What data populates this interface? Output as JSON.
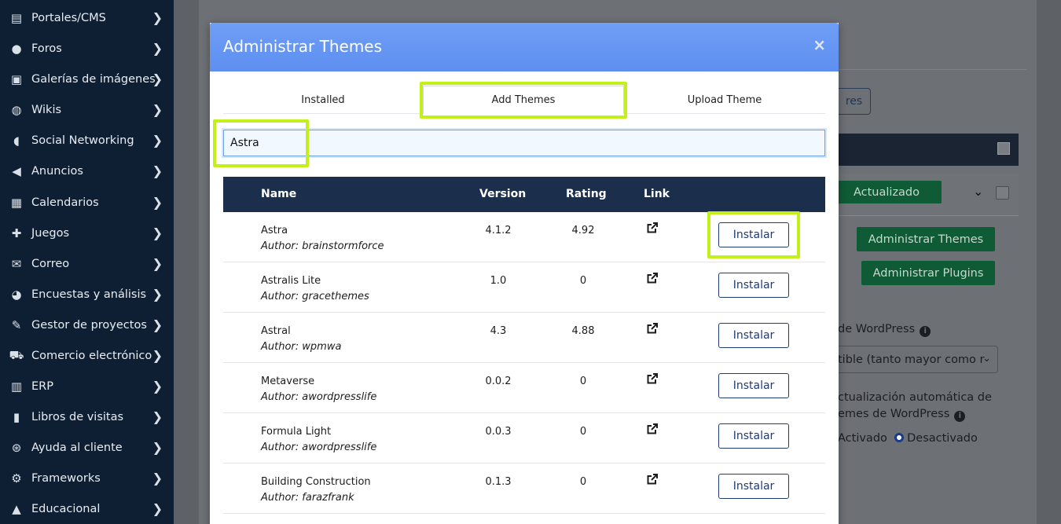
{
  "sidebar": {
    "items": [
      {
        "label": "Portales/CMS",
        "icon": "list-icon"
      },
      {
        "label": "Foros",
        "icon": "users-icon"
      },
      {
        "label": "Galerías de imágenes",
        "icon": "image-icon"
      },
      {
        "label": "Wikis",
        "icon": "globe-icon"
      },
      {
        "label": "Social Networking",
        "icon": "comments-icon"
      },
      {
        "label": "Anuncios",
        "icon": "megaphone-icon"
      },
      {
        "label": "Calendarios",
        "icon": "calendar-icon"
      },
      {
        "label": "Juegos",
        "icon": "gamepad-icon"
      },
      {
        "label": "Correo",
        "icon": "envelope-icon"
      },
      {
        "label": "Encuestas y análisis",
        "icon": "pie-chart-icon"
      },
      {
        "label": "Gestor de proyectos",
        "icon": "edit-icon"
      },
      {
        "label": "Comercio electrónico",
        "icon": "cart-icon"
      },
      {
        "label": "ERP",
        "icon": "bar-chart-icon"
      },
      {
        "label": "Libros de visitas",
        "icon": "book-icon"
      },
      {
        "label": "Ayuda al cliente",
        "icon": "lifebuoy-icon"
      },
      {
        "label": "Frameworks",
        "icon": "cogs-icon"
      },
      {
        "label": "Educacional",
        "icon": "graduation-cap-icon"
      }
    ]
  },
  "background": {
    "partial_button_label": "res",
    "updated_label": "Actualizado",
    "manage_themes_label": "Administrar Themes",
    "manage_plugins_label": "Administrar Plugins",
    "wp_label": "de WordPress",
    "select_value": "tible (tanto mayor como r",
    "auto_update_line1": "ctualización automática de",
    "auto_update_line2": "emes de WordPress",
    "radio_on": "Activado",
    "radio_off": "Desactivado"
  },
  "modal": {
    "title": "Administrar Themes",
    "close_symbol": "×",
    "tabs": [
      "Installed",
      "Add Themes",
      "Upload Theme"
    ],
    "active_tab": "Add Themes",
    "search_value": "Astra",
    "columns": {
      "name": "Name",
      "version": "Version",
      "rating": "Rating",
      "link": "Link"
    },
    "install_label": "Instalar",
    "rows": [
      {
        "name": "Astra",
        "author": "Author: brainstormforce",
        "version": "4.1.2",
        "rating": "4.92"
      },
      {
        "name": "Astralis Lite",
        "author": "Author: gracethemes",
        "version": "1.0",
        "rating": "0"
      },
      {
        "name": "Astral",
        "author": "Author: wpmwa",
        "version": "4.3",
        "rating": "4.88"
      },
      {
        "name": "Metaverse",
        "author": "Author: awordpresslife",
        "version": "0.0.2",
        "rating": "0"
      },
      {
        "name": "Formula Light",
        "author": "Author: awordpresslife",
        "version": "0.0.3",
        "rating": "0"
      },
      {
        "name": "Building Construction",
        "author": "Author: farazfrank",
        "version": "0.1.3",
        "rating": "0"
      }
    ]
  },
  "colors": {
    "sidebar_bg": "#0f1f33",
    "modal_header": "#6f9ef6",
    "table_header": "#1b2f4d",
    "highlight": "#c4f01a",
    "install_border": "#1d3c78"
  }
}
